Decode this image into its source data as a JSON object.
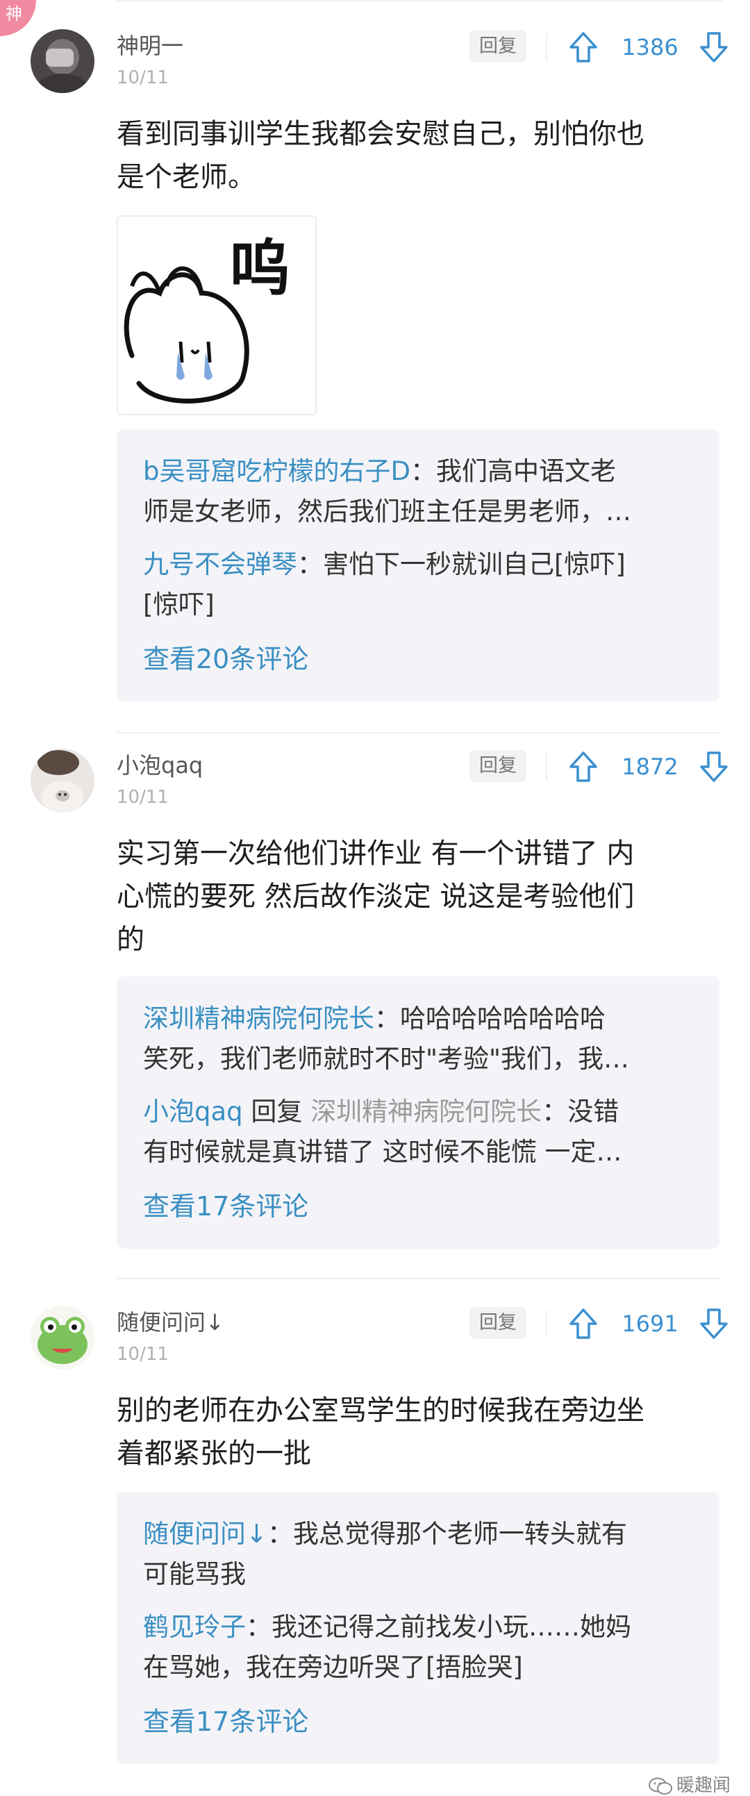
{
  "badge": {
    "label": "神"
  },
  "comments": [
    {
      "username": "神明一",
      "date": "10/11",
      "reply_label": "回复",
      "votes": "1386",
      "text_lines": [
        "看到同事训学生我都会安慰自己，别怕你也",
        "是个老师。"
      ],
      "sticker_text": "呜",
      "replies": [
        {
          "name": "b吴哥窟吃柠檬的右子D",
          "sep": "：",
          "lines": [
            "我们高中语文老",
            "师是女老师，然后我们班主任是男老师，…"
          ]
        },
        {
          "name": "九号不会弹琴",
          "sep": "：",
          "lines": [
            "害怕下一秒就训自己[惊吓]",
            "[惊吓]"
          ]
        }
      ],
      "more": "查看20条评论"
    },
    {
      "username": "小泡qaq",
      "date": "10/11",
      "reply_label": "回复",
      "votes": "1872",
      "text_lines": [
        "实习第一次给他们讲作业 有一个讲错了 内",
        "心慌的要死 然后故作淡定 说这是考验他们",
        "的"
      ],
      "replies": [
        {
          "name": "深圳精神病院何院长",
          "sep": "：",
          "lines": [
            "哈哈哈哈哈哈哈哈",
            "笑死，我们老师就时不时\"考验\"我们，我…"
          ]
        },
        {
          "name": "小泡qaq",
          "mid": " 回复 ",
          "target": "深圳精神病院何院长",
          "sep": "：",
          "lines": [
            "没错",
            "有时候就是真讲错了 这时候不能慌 一定…"
          ]
        }
      ],
      "more": "查看17条评论"
    },
    {
      "username": "随便问问↓",
      "date": "10/11",
      "reply_label": "回复",
      "votes": "1691",
      "text_lines": [
        "别的老师在办公室骂学生的时候我在旁边坐",
        "着都紧张的一批"
      ],
      "replies": [
        {
          "name": "随便问问↓",
          "sep": "：",
          "lines": [
            "我总觉得那个老师一转头就有",
            "可能骂我"
          ]
        },
        {
          "name": "鹤见玲子",
          "sep": "：",
          "lines": [
            "我还记得之前找发小玩……她妈",
            "在骂她，我在旁边听哭了[捂脸哭]"
          ]
        }
      ],
      "more": "查看17条评论"
    }
  ],
  "watermark": {
    "text": "暖趣闻"
  },
  "colors": {
    "accent": "#3a8fd0",
    "link": "#3a8fc2",
    "reply_bg": "#f4f4f8",
    "badge": "#f08aa0"
  }
}
